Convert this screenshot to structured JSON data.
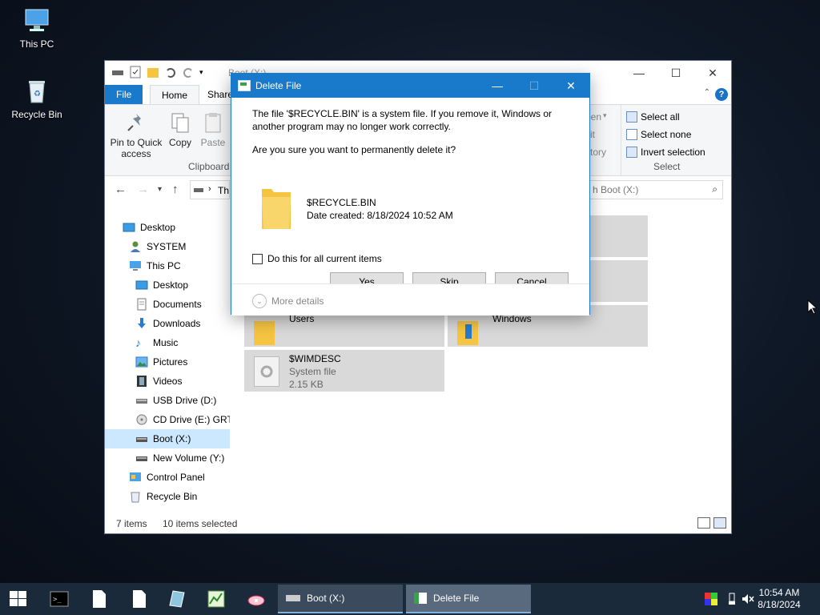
{
  "desktop": {
    "icons": [
      {
        "label": "This PC"
      },
      {
        "label": "Recycle Bin"
      }
    ]
  },
  "explorer": {
    "title": "Boot (X:)",
    "tabs": {
      "file": "File",
      "home": "Home",
      "share": "Share"
    },
    "ribbon": {
      "pin_label_1": "Pin to Quick",
      "pin_label_2": "access",
      "copy_label": "Copy",
      "paste_label": "Paste",
      "clipboard_group": "Clipboard",
      "partial_open": "pen",
      "partial_edit": "it",
      "partial_history": "story",
      "select_all": "Select all",
      "select_none": "Select none",
      "invert_selection": "Invert selection",
      "select_group": "Select"
    },
    "address_partial": "Th",
    "search_placeholder": "h Boot (X:)",
    "nav": [
      {
        "label": "Desktop"
      },
      {
        "label": "SYSTEM"
      },
      {
        "label": "This PC"
      },
      {
        "label": "Desktop"
      },
      {
        "label": "Documents"
      },
      {
        "label": "Downloads"
      },
      {
        "label": "Music"
      },
      {
        "label": "Pictures"
      },
      {
        "label": "Videos"
      },
      {
        "label": "USB Drive (D:)"
      },
      {
        "label": "CD Drive (E:) GRTM"
      },
      {
        "label": "Boot (X:)"
      },
      {
        "label": "New Volume (Y:)"
      },
      {
        "label": "Control Panel"
      },
      {
        "label": "Recycle Bin"
      }
    ],
    "items": [
      {
        "name": "Users"
      },
      {
        "name": "Windows"
      },
      {
        "name": "$WIMDESC",
        "type": "System file",
        "size": "2.15 KB"
      }
    ],
    "status": {
      "count": "7 items",
      "selected": "10 items selected"
    }
  },
  "dialog": {
    "title": "Delete File",
    "message": "The file '$RECYCLE.BIN' is a system file. If you remove it, Windows or another program may no longer work correctly.",
    "question": "Are you sure you want to permanently delete it?",
    "file_name": "$RECYCLE.BIN",
    "file_date": "Date created: 8/18/2024 10:52 AM",
    "checkbox_label": "Do this for all current items",
    "yes": "Yes",
    "skip": "Skip",
    "cancel": "Cancel",
    "more_details": "More details"
  },
  "taskbar": {
    "tasks": [
      {
        "label": "Boot (X:)"
      },
      {
        "label": "Delete File"
      }
    ],
    "time": "10:54 AM",
    "date": "8/18/2024"
  },
  "colors": {
    "accent": "#1979ca",
    "selection": "#cce8ff",
    "folder": "#f5c542"
  }
}
